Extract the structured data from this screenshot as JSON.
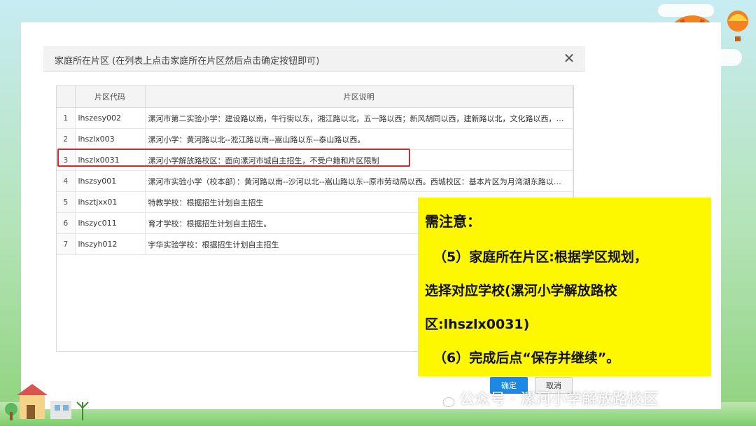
{
  "dialog": {
    "title": "家庭所在片区 (在列表上点击家庭所在片区然后点击确定按钮即可)",
    "close_glyph": "✕"
  },
  "table": {
    "headers": [
      "",
      "片区代码",
      "片区说明"
    ],
    "rows": [
      {
        "num": "1",
        "code": "lhszesy002",
        "desc": "漯河市第二实验小学：建设路以南，牛行街以东，湘江路以北，五一路以西；新风胡同以西，建新路以北，文化路以西，…"
      },
      {
        "num": "2",
        "code": "lhszlx003",
        "desc": "漯河小学：黄河路以北--淞江路以南--嵩山路以东--泰山路以西。"
      },
      {
        "num": "3",
        "code": "lhszlx0031",
        "desc": "漯河小学解放路校区：面向漯河市城自主招生，不受户籍和片区限制"
      },
      {
        "num": "4",
        "code": "lhszsy001",
        "desc": "漯河市实验小学（校本部）：黄河路以南--沙河以北--嵩山路以东--原市劳动局以西。西城校区：基本片区为月湾湖东路以…"
      },
      {
        "num": "5",
        "code": "lhsztjxx01",
        "desc": "特教学校：根据招生计划自主招生"
      },
      {
        "num": "6",
        "code": "lhszyc011",
        "desc": "育才学校：根据招生计划自主招生。"
      },
      {
        "num": "7",
        "code": "lhszyh012",
        "desc": "宇华实验学校：根据招生计划自主招生"
      }
    ]
  },
  "note": {
    "title": "需注意：",
    "line1": "（5）家庭所在片区:根据学区规划，",
    "line2": "选择对应学校(漯河小学解放路校",
    "line3": "区:lhszlx0031)",
    "line4": "（6）完成后点“保存并继续”。"
  },
  "buttons": {
    "ok": "确定",
    "cancel": "取消"
  },
  "watermark": {
    "text": "公众号 · 漯河小学解放路校区"
  },
  "colors": {
    "highlight": "#d8262f",
    "note_bg": "#fdf700",
    "primary": "#1e88e5"
  }
}
